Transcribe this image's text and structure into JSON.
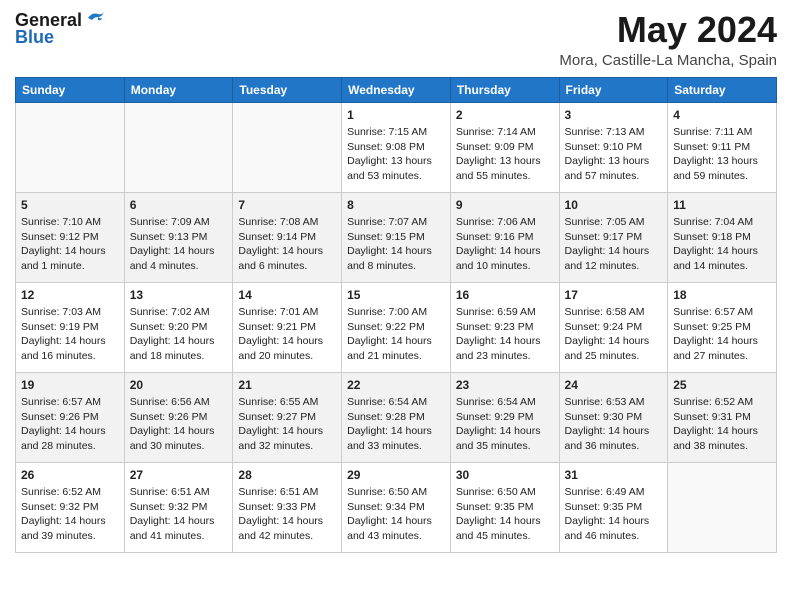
{
  "logo": {
    "general": "General",
    "blue": "Blue"
  },
  "title": "May 2024",
  "location": "Mora, Castille-La Mancha, Spain",
  "weekdays": [
    "Sunday",
    "Monday",
    "Tuesday",
    "Wednesday",
    "Thursday",
    "Friday",
    "Saturday"
  ],
  "weeks": [
    [
      {
        "day": "",
        "info": ""
      },
      {
        "day": "",
        "info": ""
      },
      {
        "day": "",
        "info": ""
      },
      {
        "day": "1",
        "info": "Sunrise: 7:15 AM\nSunset: 9:08 PM\nDaylight: 13 hours and 53 minutes."
      },
      {
        "day": "2",
        "info": "Sunrise: 7:14 AM\nSunset: 9:09 PM\nDaylight: 13 hours and 55 minutes."
      },
      {
        "day": "3",
        "info": "Sunrise: 7:13 AM\nSunset: 9:10 PM\nDaylight: 13 hours and 57 minutes."
      },
      {
        "day": "4",
        "info": "Sunrise: 7:11 AM\nSunset: 9:11 PM\nDaylight: 13 hours and 59 minutes."
      }
    ],
    [
      {
        "day": "5",
        "info": "Sunrise: 7:10 AM\nSunset: 9:12 PM\nDaylight: 14 hours and 1 minute."
      },
      {
        "day": "6",
        "info": "Sunrise: 7:09 AM\nSunset: 9:13 PM\nDaylight: 14 hours and 4 minutes."
      },
      {
        "day": "7",
        "info": "Sunrise: 7:08 AM\nSunset: 9:14 PM\nDaylight: 14 hours and 6 minutes."
      },
      {
        "day": "8",
        "info": "Sunrise: 7:07 AM\nSunset: 9:15 PM\nDaylight: 14 hours and 8 minutes."
      },
      {
        "day": "9",
        "info": "Sunrise: 7:06 AM\nSunset: 9:16 PM\nDaylight: 14 hours and 10 minutes."
      },
      {
        "day": "10",
        "info": "Sunrise: 7:05 AM\nSunset: 9:17 PM\nDaylight: 14 hours and 12 minutes."
      },
      {
        "day": "11",
        "info": "Sunrise: 7:04 AM\nSunset: 9:18 PM\nDaylight: 14 hours and 14 minutes."
      }
    ],
    [
      {
        "day": "12",
        "info": "Sunrise: 7:03 AM\nSunset: 9:19 PM\nDaylight: 14 hours and 16 minutes."
      },
      {
        "day": "13",
        "info": "Sunrise: 7:02 AM\nSunset: 9:20 PM\nDaylight: 14 hours and 18 minutes."
      },
      {
        "day": "14",
        "info": "Sunrise: 7:01 AM\nSunset: 9:21 PM\nDaylight: 14 hours and 20 minutes."
      },
      {
        "day": "15",
        "info": "Sunrise: 7:00 AM\nSunset: 9:22 PM\nDaylight: 14 hours and 21 minutes."
      },
      {
        "day": "16",
        "info": "Sunrise: 6:59 AM\nSunset: 9:23 PM\nDaylight: 14 hours and 23 minutes."
      },
      {
        "day": "17",
        "info": "Sunrise: 6:58 AM\nSunset: 9:24 PM\nDaylight: 14 hours and 25 minutes."
      },
      {
        "day": "18",
        "info": "Sunrise: 6:57 AM\nSunset: 9:25 PM\nDaylight: 14 hours and 27 minutes."
      }
    ],
    [
      {
        "day": "19",
        "info": "Sunrise: 6:57 AM\nSunset: 9:26 PM\nDaylight: 14 hours and 28 minutes."
      },
      {
        "day": "20",
        "info": "Sunrise: 6:56 AM\nSunset: 9:26 PM\nDaylight: 14 hours and 30 minutes."
      },
      {
        "day": "21",
        "info": "Sunrise: 6:55 AM\nSunset: 9:27 PM\nDaylight: 14 hours and 32 minutes."
      },
      {
        "day": "22",
        "info": "Sunrise: 6:54 AM\nSunset: 9:28 PM\nDaylight: 14 hours and 33 minutes."
      },
      {
        "day": "23",
        "info": "Sunrise: 6:54 AM\nSunset: 9:29 PM\nDaylight: 14 hours and 35 minutes."
      },
      {
        "day": "24",
        "info": "Sunrise: 6:53 AM\nSunset: 9:30 PM\nDaylight: 14 hours and 36 minutes."
      },
      {
        "day": "25",
        "info": "Sunrise: 6:52 AM\nSunset: 9:31 PM\nDaylight: 14 hours and 38 minutes."
      }
    ],
    [
      {
        "day": "26",
        "info": "Sunrise: 6:52 AM\nSunset: 9:32 PM\nDaylight: 14 hours and 39 minutes."
      },
      {
        "day": "27",
        "info": "Sunrise: 6:51 AM\nSunset: 9:32 PM\nDaylight: 14 hours and 41 minutes."
      },
      {
        "day": "28",
        "info": "Sunrise: 6:51 AM\nSunset: 9:33 PM\nDaylight: 14 hours and 42 minutes."
      },
      {
        "day": "29",
        "info": "Sunrise: 6:50 AM\nSunset: 9:34 PM\nDaylight: 14 hours and 43 minutes."
      },
      {
        "day": "30",
        "info": "Sunrise: 6:50 AM\nSunset: 9:35 PM\nDaylight: 14 hours and 45 minutes."
      },
      {
        "day": "31",
        "info": "Sunrise: 6:49 AM\nSunset: 9:35 PM\nDaylight: 14 hours and 46 minutes."
      },
      {
        "day": "",
        "info": ""
      }
    ]
  ]
}
